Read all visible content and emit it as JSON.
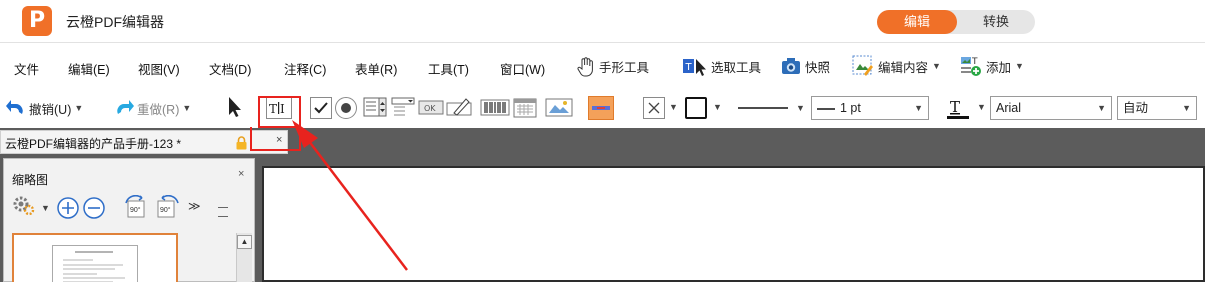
{
  "app": {
    "title": "云橙PDF编辑器",
    "logo_letter": "P",
    "modes": {
      "edit": "编辑",
      "convert": "转换"
    }
  },
  "menu": {
    "items": [
      "文件",
      "编辑(E)",
      "视图(V)",
      "文档(D)",
      "注释(C)",
      "表单(R)",
      "工具(T)",
      "窗口(W)"
    ],
    "hand_tool": "手形工具",
    "select_tool": "选取工具",
    "snapshot": "快照",
    "edit_content": "编辑内容",
    "add": "添加"
  },
  "toolbar": {
    "undo": "撤销(U)",
    "redo": "重做(R)",
    "line_width": "1 pt",
    "font": "Arial",
    "font_size": "自动"
  },
  "tab": {
    "title": "云橙PDF编辑器的产品手册-123 *",
    "close": "×"
  },
  "panel": {
    "title": "缩略图",
    "close": "×",
    "rotate_left": "90°",
    "rotate_right": "90°"
  },
  "colors": {
    "brand": "#f07028",
    "highlight": "#e8231e",
    "workspace": "#5c5c5c"
  },
  "icons": [
    "app-logo",
    "hand-icon",
    "select-text-icon",
    "camera-icon",
    "edit-content-icon",
    "add-icon",
    "undo-icon",
    "redo-icon",
    "arrow-cursor-icon",
    "text-field-icon",
    "checkbox-icon",
    "radio-icon",
    "listbox-icon",
    "dropdown-field-icon",
    "button-field-icon",
    "signature-icon",
    "barcode-icon",
    "date-icon",
    "image-field-icon",
    "link-icon",
    "cross-box-icon",
    "border-color-icon",
    "line-style-icon",
    "font-color-icon",
    "lock-icon",
    "zoom-in-icon",
    "zoom-out-icon",
    "rotate-left-icon",
    "rotate-right-icon"
  ]
}
